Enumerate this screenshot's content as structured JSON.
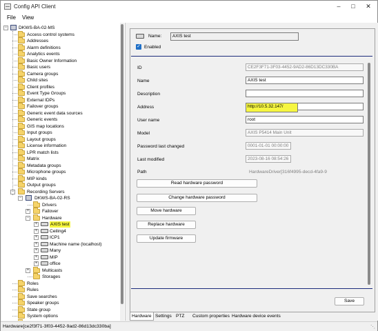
{
  "window": {
    "title": "Config API Client"
  },
  "menu": [
    {
      "label": "File"
    },
    {
      "label": "View"
    }
  ],
  "tree": {
    "root": "DKWS-BA-02-MS",
    "items": [
      "Access control systems",
      "Addresses",
      "Alarm definitions",
      "Analytics events",
      "Basic Owner Information",
      "Basic users",
      "Camera groups",
      "Child sites",
      "Client profiles",
      "Event Type Groups",
      "External IDPs",
      "Failover groups",
      "Generic event data sources",
      "Generic events",
      "GIS map locations",
      "Input groups",
      "Layout groups",
      "License information",
      "LPR match lists",
      "Matrix",
      "Metadata groups",
      "Microphone groups",
      "MIP kinds",
      "Output groups"
    ],
    "recording_servers": "Recording Servers",
    "recording_server": "DKWS-BA-02-RS",
    "rs_children": [
      "Drivers",
      "Failover",
      "Hardware"
    ],
    "hardware_items": [
      "AXIS test",
      "Ceiling4",
      "ICP1",
      "Machine name (localhost)",
      "Many",
      "MIP",
      "office"
    ],
    "rs_after": [
      "Multicasts",
      "Storages"
    ],
    "tail_items": [
      "Roles",
      "Rules",
      "Save searches",
      "Speaker groups",
      "State group",
      "System options",
      "Time profiles"
    ]
  },
  "detail": {
    "name_label": "Name:",
    "name_value": "AXIS test",
    "enabled_label": "Enabled",
    "fields": {
      "id_label": "ID",
      "id_value": "CE2F3F71-3F03-4452-9AD2-86D13DC330BA",
      "name_label": "Name",
      "name_value": "AXIS test",
      "description_label": "Description",
      "description_value": "",
      "address_label": "Address",
      "address_value": "http://10.5.32.147/",
      "username_label": "User name",
      "username_value": "root",
      "model_label": "Model",
      "model_value": "AXIS P5414 Main Unit",
      "pwd_changed_label": "Password last changed",
      "pwd_changed_value": "0001-01-01 00:00:00",
      "last_modified_label": "Last modified",
      "last_modified_value": "2023-08-16 08:54:26",
      "path_label": "Path",
      "path_value": "HardwareDriver[316f4995-decd-4fa9-9"
    },
    "buttons": {
      "read_pwd": "Read hardware password",
      "change_pwd": "Change hardware password",
      "move": "Move hardware",
      "replace": "Replace hardware",
      "update_fw": "Update firmware",
      "save": "Save"
    },
    "tabs": [
      "Hardware",
      "Settings",
      "PTZ",
      "Custom properties",
      "Hardware device events"
    ]
  },
  "status": {
    "text": "Hardware[ce2f3f71-3f03-4452-9ad2-86d13dc330ba]"
  },
  "colors": {
    "highlight": "#f6f640",
    "accent": "#1e6fc7",
    "separator": "#1a2a7a"
  }
}
